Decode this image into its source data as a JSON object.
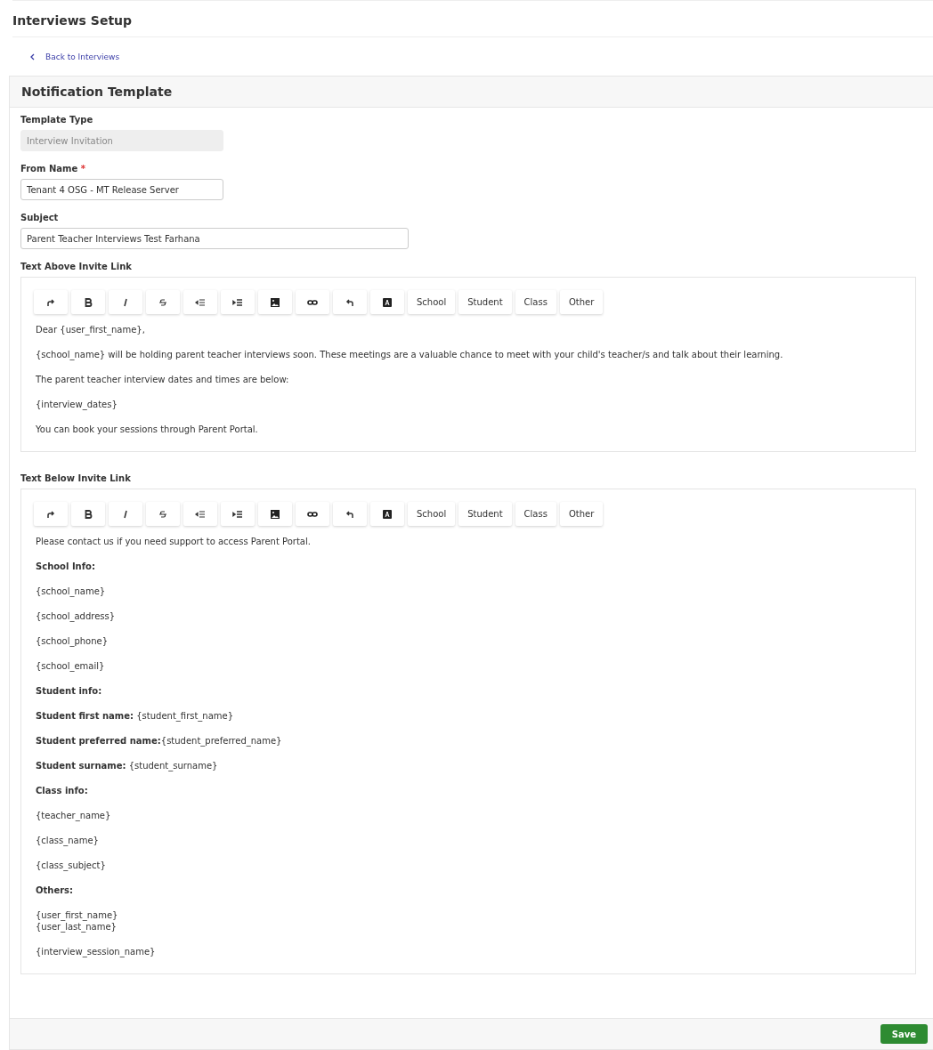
{
  "page_title": "Interviews Setup",
  "back_link": "Back to Interviews",
  "card": {
    "title": "Notification Template",
    "fields": [
      {
        "label": "Template Type",
        "value": "Interview Invitation",
        "disabled": true,
        "wide": false
      },
      {
        "label": "From Name",
        "required_mark": "*",
        "value": "Tenant 4 OSG - MT Release Server",
        "disabled": false,
        "wide": false
      },
      {
        "label": "Subject",
        "value": "Parent Teacher Interviews Test Farhana",
        "disabled": false,
        "wide": true
      }
    ],
    "editors": [
      {
        "label": "Text Above Invite Link",
        "insert_menus": [
          "School",
          "Student",
          "Class",
          "Other"
        ],
        "paragraphs": [
          {
            "kind": "text",
            "text": "Dear {user_first_name},"
          },
          {
            "kind": "text",
            "text": "{school_name} will be holding parent teacher interviews soon. These meetings are a valuable chance to meet with your child's teacher/s and talk about their learning."
          },
          {
            "kind": "text",
            "text": "The parent teacher interview dates and times are below:"
          },
          {
            "kind": "text",
            "text": "{interview_dates}"
          },
          {
            "kind": "text",
            "text": "You can book your sessions through Parent Portal."
          }
        ]
      },
      {
        "label": "Text Below Invite Link",
        "insert_menus": [
          "School",
          "Student",
          "Class",
          "Other"
        ],
        "paragraphs": [
          {
            "kind": "text",
            "text": "Please contact us if you need support to access Parent Portal."
          },
          {
            "kind": "heading",
            "text": "School Info:"
          },
          {
            "kind": "text",
            "text": "{school_name}"
          },
          {
            "kind": "text",
            "text": "{school_address}"
          },
          {
            "kind": "text",
            "text": "{school_phone}"
          },
          {
            "kind": "text",
            "text": "{school_email}"
          },
          {
            "kind": "heading",
            "text": "Student info:"
          },
          {
            "kind": "text",
            "text": "**Student first name:** {student_first_name}"
          },
          {
            "kind": "text",
            "text": "**Student preferred name:**{student_preferred_name}"
          },
          {
            "kind": "text",
            "text": "**Student surname:** {student_surname}"
          },
          {
            "kind": "heading",
            "text": "Class info:"
          },
          {
            "kind": "text",
            "text": "{teacher_name}"
          },
          {
            "kind": "text",
            "text": "{class_name}"
          },
          {
            "kind": "text",
            "text": "{class_subject}"
          },
          {
            "kind": "heading",
            "text": "Others:"
          },
          {
            "kind": "lines",
            "lines": [
              "{user_first_name}",
              "{user_last_name}"
            ]
          },
          {
            "kind": "text",
            "text": "{interview_session_name}"
          }
        ]
      }
    ],
    "save_button": "Save"
  }
}
